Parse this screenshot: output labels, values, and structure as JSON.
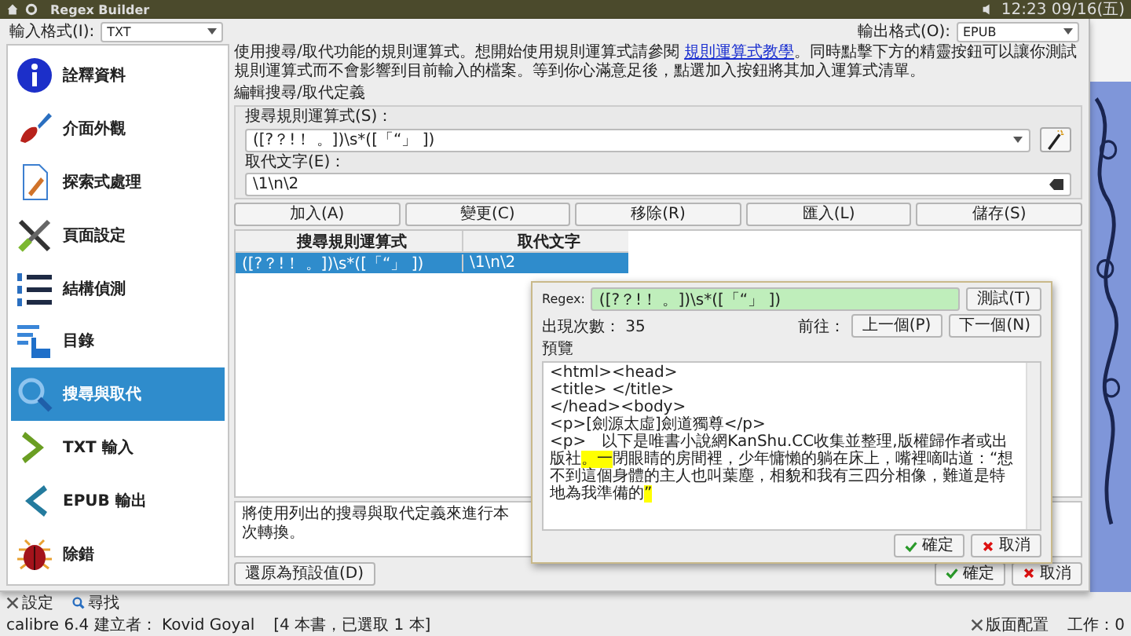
{
  "top_panel": {
    "title": "Regex Builder",
    "clock": "12:23 09/16(五)"
  },
  "dialog": {
    "input_format_label": "輸入格式(I):",
    "input_format": "TXT",
    "output_format_label": "輸出格式(O):",
    "output_format": "EPUB",
    "sidebar": [
      {
        "label": "詮釋資料",
        "selected": false
      },
      {
        "label": "介面外觀",
        "selected": false
      },
      {
        "label": "探索式處理",
        "selected": false
      },
      {
        "label": "頁面設定",
        "selected": false
      },
      {
        "label": "結構偵測",
        "selected": false
      },
      {
        "label": "目錄",
        "selected": false
      },
      {
        "label": "搜尋與取代",
        "selected": true
      },
      {
        "label": "TXT 輸入",
        "selected": false
      },
      {
        "label": "EPUB 輸出",
        "selected": false
      },
      {
        "label": "除錯",
        "selected": false
      }
    ],
    "intro": "使用搜尋/取代功能的規則運算式。想開始使用規則運算式請參閱",
    "intro_link": "規則運算式教學",
    "intro_rest": "。同時點擊下方的精靈按鈕可以讓你測試規則運算式而不會影響到目前輸入的檔案。等到你心滿意足後，點選加入按鈕將其加入運算式清單。",
    "section_title": "編輯搜尋/取代定義",
    "search_label": "搜尋規則運算式(S)：",
    "search_value": "([?？!！ 。])\\s*([「“」 ])",
    "replace_label": "取代文字(E)：",
    "replace_value": "\\1\\n\\2",
    "buttons": [
      "加入(A)",
      "變更(C)",
      "移除(R)",
      "匯入(L)",
      "儲存(S)"
    ],
    "table": {
      "columns": [
        "搜尋規則運算式",
        "取代文字"
      ],
      "rows": [
        {
          "search": "([?？!！ 。])\\s*([「“」 ])",
          "replace": "\\1\\n\\2",
          "selected": true
        }
      ]
    },
    "description": "將使用列出的搜尋與取代定義來進行本次轉換。",
    "restore_button": "還原為預設值(D)",
    "ok": "確定",
    "cancel": "取消"
  },
  "regex_builder": {
    "regex_label": "Regex:",
    "regex_value": "([?？!！ 。])\\s*([「“」 ])",
    "test_button": "測試(T)",
    "count": "出現次數： 35",
    "goto_label": "前往：",
    "prev_button": "上一個(P)",
    "next_button": "下一個(N)",
    "preview_label": "預覽",
    "preview_lines": [
      "<html><head>",
      "<title> </title>",
      "</head><body>",
      "<p>[劍源太虛]劍道獨尊</p>"
    ],
    "preview_paragraph": [
      {
        "text": "<p>　以下是唯書小說網KanShu.CC收集並整理,版權歸作者或出版社",
        "match": false
      },
      {
        "text": "。一",
        "match": true
      },
      {
        "text": "閉眼睛的房間裡，少年慵懶的躺在床上，嘴裡嘀咕道：“想不到這個身體的主人也叫葉塵，相貌和我有三四分相像，難道是特地為我準備的",
        "match": false
      },
      {
        "text": "” ",
        "match": true
      }
    ],
    "ok": "確定",
    "cancel": "取消"
  },
  "main_window": {
    "settings": "設定",
    "find": "尋找",
    "status": "calibre 6.4 建立者： Kovid Goyal",
    "books": "[4 本書，已選取 1 本]",
    "layout": "版面配置",
    "jobs": "工作：0"
  }
}
